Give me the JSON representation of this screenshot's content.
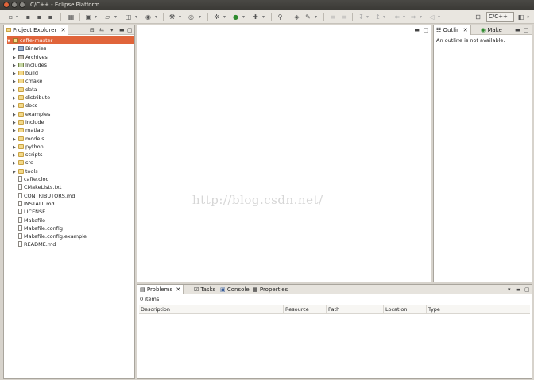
{
  "window": {
    "title": "C/C++ - Eclipse Platform"
  },
  "toolbar": {
    "perspective_label": "C/C++"
  },
  "project_explorer": {
    "tab_label": "Project Explorer",
    "items": [
      {
        "label": "caffe-master",
        "kind": "project",
        "twisty": "▼",
        "indent": 0,
        "selected": true
      },
      {
        "label": "Binaries",
        "kind": "bin",
        "twisty": "▶",
        "indent": 1
      },
      {
        "label": "Archives",
        "kind": "arch",
        "twisty": "▶",
        "indent": 1
      },
      {
        "label": "Includes",
        "kind": "inc",
        "twisty": "▶",
        "indent": 1
      },
      {
        "label": "build",
        "kind": "folder",
        "twisty": "▶",
        "indent": 1
      },
      {
        "label": "cmake",
        "kind": "folder",
        "twisty": "▶",
        "indent": 1
      },
      {
        "label": "data",
        "kind": "folder",
        "twisty": "▶",
        "indent": 1
      },
      {
        "label": "distribute",
        "kind": "folder",
        "twisty": "▶",
        "indent": 1
      },
      {
        "label": "docs",
        "kind": "folder",
        "twisty": "▶",
        "indent": 1
      },
      {
        "label": "examples",
        "kind": "folder",
        "twisty": "▶",
        "indent": 1
      },
      {
        "label": "include",
        "kind": "folder",
        "twisty": "▶",
        "indent": 1
      },
      {
        "label": "matlab",
        "kind": "folder",
        "twisty": "▶",
        "indent": 1
      },
      {
        "label": "models",
        "kind": "folder",
        "twisty": "▶",
        "indent": 1
      },
      {
        "label": "python",
        "kind": "folder",
        "twisty": "▶",
        "indent": 1
      },
      {
        "label": "scripts",
        "kind": "folder",
        "twisty": "▶",
        "indent": 1
      },
      {
        "label": "src",
        "kind": "folder",
        "twisty": "▶",
        "indent": 1
      },
      {
        "label": "tools",
        "kind": "folder",
        "twisty": "▶",
        "indent": 1
      },
      {
        "label": "caffe.cloc",
        "kind": "file",
        "twisty": "",
        "indent": 1
      },
      {
        "label": "CMakeLists.txt",
        "kind": "file",
        "twisty": "",
        "indent": 1
      },
      {
        "label": "CONTRIBUTORS.md",
        "kind": "file",
        "twisty": "",
        "indent": 1
      },
      {
        "label": "INSTALL.md",
        "kind": "file",
        "twisty": "",
        "indent": 1
      },
      {
        "label": "LICENSE",
        "kind": "file",
        "twisty": "",
        "indent": 1
      },
      {
        "label": "Makefile",
        "kind": "file",
        "twisty": "",
        "indent": 1
      },
      {
        "label": "Makefile.config",
        "kind": "file",
        "twisty": "",
        "indent": 1
      },
      {
        "label": "Makefile.config.example",
        "kind": "file",
        "twisty": "",
        "indent": 1
      },
      {
        "label": "README.md",
        "kind": "file",
        "twisty": "",
        "indent": 1
      }
    ]
  },
  "editor": {
    "watermark": "http://blog.csdn.net/"
  },
  "outline": {
    "tab_label": "Outlin",
    "make_tab_label": "Make",
    "message": "An outline is not available."
  },
  "bottom_panel": {
    "tabs": [
      {
        "label": "Problems",
        "active": true,
        "icon": "problems-icon"
      },
      {
        "label": "Tasks",
        "active": false,
        "icon": "tasks-icon"
      },
      {
        "label": "Console",
        "active": false,
        "icon": "console-icon"
      },
      {
        "label": "Properties",
        "active": false,
        "icon": "properties-icon"
      }
    ],
    "items_count": "0 items",
    "columns": [
      "Description",
      "Resource",
      "Path",
      "Location",
      "Type"
    ]
  }
}
